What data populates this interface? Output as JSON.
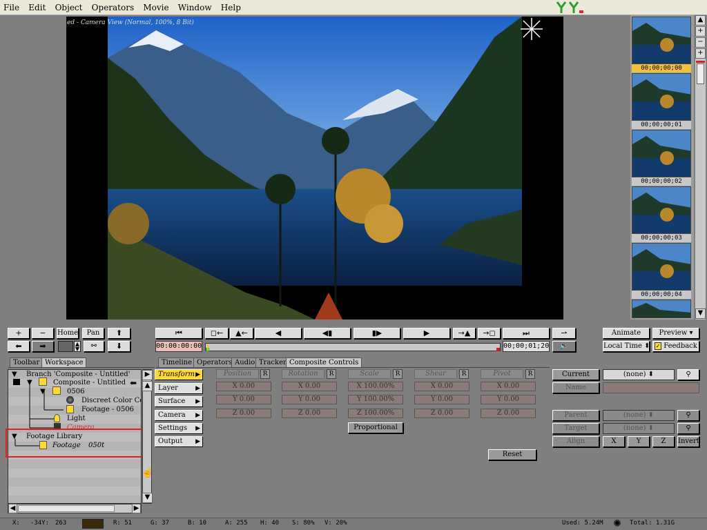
{
  "menu": [
    "File",
    "Edit",
    "Object",
    "Operators",
    "Movie",
    "Window",
    "Help"
  ],
  "viewer": {
    "title": "ed - Camera View (Normal, 100%, 8 Bit)"
  },
  "frames": [
    {
      "label": "00;00;00;00",
      "selected": true
    },
    {
      "label": "00;00;00;01",
      "selected": false
    },
    {
      "label": "00;00;00;02",
      "selected": false
    },
    {
      "label": "00;00;00;03",
      "selected": false
    },
    {
      "label": "00;00;00;04",
      "selected": false
    }
  ],
  "strip_scroll": {
    "up": "▲",
    "plus": "+",
    "minus": "−",
    "plus2": "+",
    "down": "▼"
  },
  "nav": {
    "plus": "+",
    "minus": "−",
    "home": "Home",
    "pan": "Pan"
  },
  "transport": {
    "timecode_start": "00:00:00:00",
    "timecode_end": "00;00;01;20"
  },
  "right_buttons": {
    "animate": "Animate",
    "preview": "Preview",
    "local_time": "Local Time",
    "feedback": "Feedback"
  },
  "tabs_left": [
    "Toolbar",
    "Workspace"
  ],
  "tabs_main": [
    "Timeline",
    "Operators",
    "Audio",
    "Tracker",
    "Composite Controls"
  ],
  "tree": {
    "branch": "Branch 'Composite - Untitled'",
    "composite": "Composite - Untitled",
    "item_0506": "0506",
    "color_corrector": "Discreet Color Cor",
    "footage_0506": "Footage - 0506",
    "light": "Light",
    "camera": "Camera",
    "footage_library": "Footage Library",
    "footage_item": "Footage",
    "footage_item_name": "050t"
  },
  "categories": [
    "Transform",
    "Layer",
    "Surface",
    "Camera",
    "Settings",
    "Output"
  ],
  "transform": {
    "columns": [
      "Position",
      "Rotation",
      "Scale",
      "Shear",
      "Pivot"
    ],
    "rows": [
      [
        "X 0.00",
        "X 0.00",
        "X 100.00%",
        "X 0.00",
        "X 0.00"
      ],
      [
        "Y 0.00",
        "Y 0.00",
        "Y 100.00%",
        "Y 0.00",
        "Y 0.00"
      ],
      [
        "Z 0.00",
        "Z 0.00",
        "Z 100.00%",
        "Z 0.00",
        "Z 0.00"
      ]
    ],
    "proportional": "Proportional",
    "reset": "Reset",
    "r_label": "R"
  },
  "right_panel": {
    "current_label": "Current",
    "current_value": "(none)",
    "name_label": "Name",
    "parent_label": "Parent",
    "parent_value": "(none)",
    "target_label": "Target",
    "target_value": "(none)",
    "align_label": "Align",
    "x": "X",
    "y": "Y",
    "z": "Z",
    "invert": "Invert"
  },
  "status": {
    "x": "X:",
    "xv": "-34Y:",
    "yv": "263",
    "r": "R: 51",
    "g": "G: 37",
    "b": "B: 10",
    "a": "A: 255",
    "h": "H: 40",
    "s": "S: 80%",
    "v": "V: 20%",
    "used": "Used: 5.24M",
    "total": "Total: 1.31G",
    "swatch": "#3a2a0a"
  }
}
